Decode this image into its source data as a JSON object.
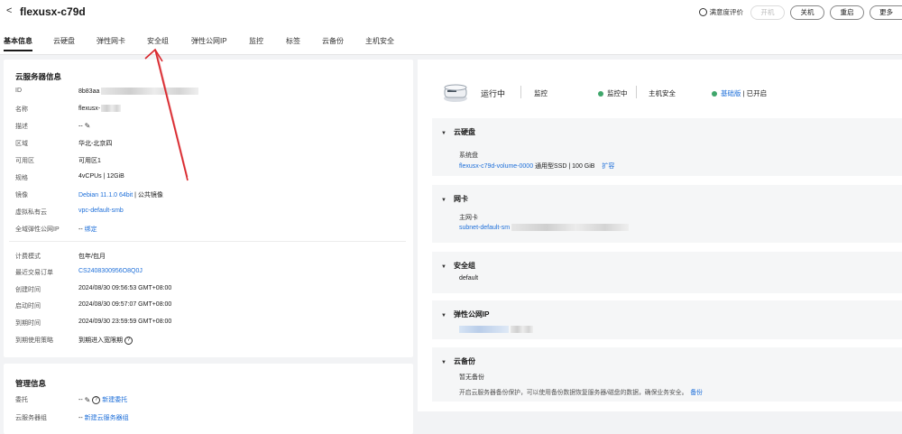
{
  "header": {
    "back_icon": "chevron-left-icon",
    "title": "flexusx-c79d",
    "rate_label": "满意度评价",
    "buttons": {
      "start": "开机",
      "shutdown": "关机",
      "restart": "重启",
      "more": "更多"
    }
  },
  "tabs": [
    "基本信息",
    "云硬盘",
    "弹性网卡",
    "安全组",
    "弹性公网IP",
    "监控",
    "标签",
    "云备份",
    "主机安全"
  ],
  "server_info": {
    "title": "云服务器信息",
    "rows": [
      {
        "label": "ID",
        "value": "8b83aa"
      },
      {
        "label": "名称",
        "value": "flexusx-"
      },
      {
        "label": "描述",
        "value": "--"
      },
      {
        "label": "区域",
        "value": "华北-北京四"
      },
      {
        "label": "可用区",
        "value": "可用区1"
      },
      {
        "label": "规格",
        "value": "4vCPUs | 12GiB"
      },
      {
        "label": "镜像",
        "value": "Debian 11.1.0 64bit",
        "suffix": "| 公共镜像"
      },
      {
        "label": "虚拟私有云",
        "value": "vpc-default-smb"
      },
      {
        "label": "全域弹性公网IP",
        "value": "--",
        "link": "绑定"
      }
    ],
    "billing_rows": [
      {
        "label": "计费模式",
        "value": "包年/包月"
      },
      {
        "label": "最近交易订单",
        "value": "CS2408300956O8Q0J"
      },
      {
        "label": "创建时间",
        "value": "2024/08/30 09:56:53 GMT+08:00"
      },
      {
        "label": "启动时间",
        "value": "2024/08/30 09:57:07 GMT+08:00"
      },
      {
        "label": "到期时间",
        "value": "2024/09/30 23:59:59 GMT+08:00"
      },
      {
        "label": "到期使用策略",
        "value": "到期进入宽限期"
      }
    ]
  },
  "management": {
    "title": "管理信息",
    "rows": [
      {
        "label": "委托",
        "value": "--",
        "link": "新建委托"
      },
      {
        "label": "云服务器组",
        "value": "--",
        "link": "新建云服务器组"
      }
    ]
  },
  "status": {
    "state": "运行中",
    "monitor_label": "监控",
    "monitor_value": "监控中",
    "security_label": "主机安全",
    "security_value": "基础版",
    "security_suffix": "| 已开启"
  },
  "panels": {
    "disk": {
      "title": "云硬盘",
      "sub": "系统盘",
      "volume": "flexusx-c79d-volume-0000",
      "detail": "通用型SSD | 100 GiB",
      "action": "扩容"
    },
    "nic": {
      "title": "网卡",
      "sub": "主网卡",
      "value": "subnet-default-sm"
    },
    "sg": {
      "title": "安全组",
      "value": "default"
    },
    "eip": {
      "title": "弹性公网IP"
    },
    "backup": {
      "title": "云备份",
      "line1": "暂无备份",
      "line2": "开启云服务器备份保护，可以使用备份数据恢复服务器/磁盘的数据，确保业务安全。",
      "link": "备份"
    }
  },
  "colors": {
    "link": "#1e6fd9",
    "running": "#3fa66b",
    "annotation": "#d9262c"
  }
}
